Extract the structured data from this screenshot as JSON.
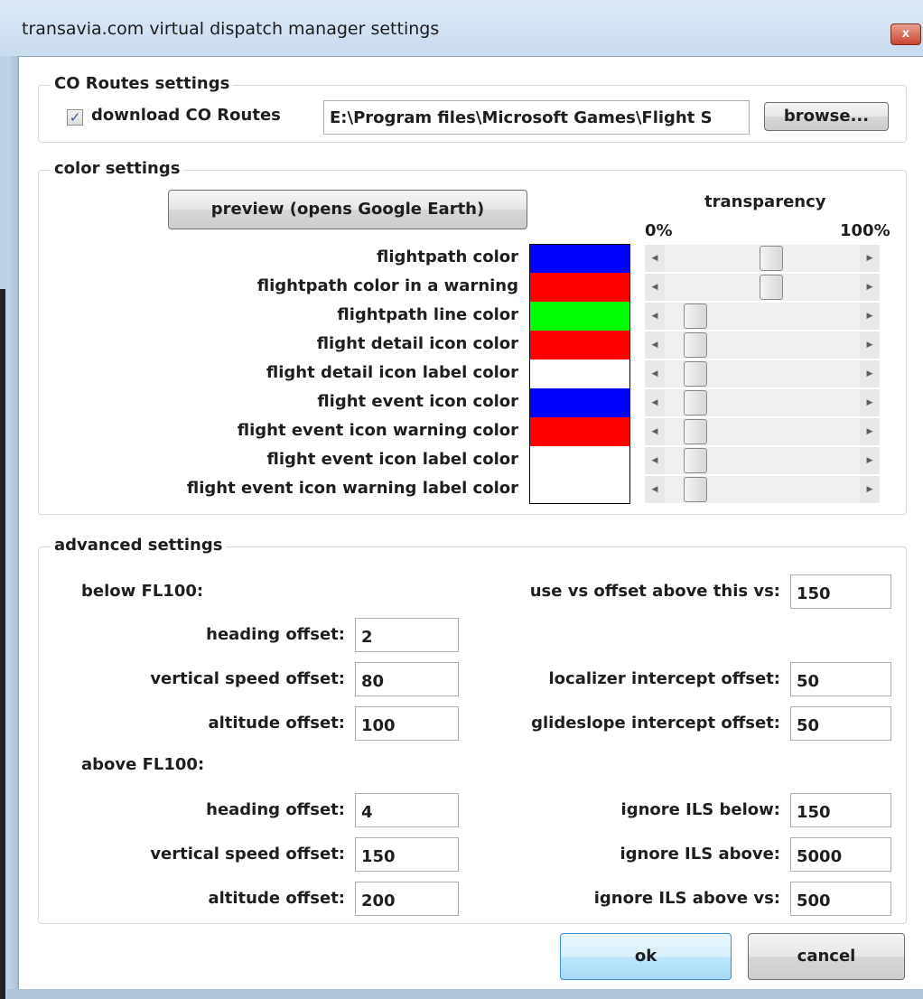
{
  "window": {
    "title": "transavia.com virtual dispatch manager settings",
    "close_glyph": "x"
  },
  "co_routes": {
    "legend": "CO Routes settings",
    "download_label": "download CO Routes",
    "download_checked": true,
    "path": "E:\\Program files\\Microsoft Games\\Flight S",
    "browse_label": "browse..."
  },
  "colors": {
    "legend": "color settings",
    "preview_label": "preview (opens Google Earth)",
    "transparency_label": "transparency",
    "min_label": "0%",
    "max_label": "100%",
    "items": [
      {
        "label": "flightpath color",
        "color": "#0000ff",
        "transparency": 0.55
      },
      {
        "label": "flightpath color in a warning",
        "color": "#ff0000",
        "transparency": 0.55
      },
      {
        "label": "flightpath line color",
        "color": "#00ff00",
        "transparency": 0.11
      },
      {
        "label": "flight detail icon color",
        "color": "#ff0000",
        "transparency": 0.11
      },
      {
        "label": "flight detail icon label color",
        "color": "#ffffff",
        "transparency": 0.11
      },
      {
        "label": "flight event icon color",
        "color": "#0000ff",
        "transparency": 0.11
      },
      {
        "label": "flight event icon warning color",
        "color": "#ff0000",
        "transparency": 0.11
      },
      {
        "label": "flight event icon label color",
        "color": "#ffffff",
        "transparency": 0.11
      },
      {
        "label": "flight event icon warning label color",
        "color": "#ffffff",
        "transparency": 0.11
      }
    ]
  },
  "advanced": {
    "legend": "advanced settings",
    "below_label": "below FL100:",
    "above_label": "above FL100:",
    "below": [
      {
        "label": "heading offset:",
        "value": "2"
      },
      {
        "label": "vertical speed offset:",
        "value": "80"
      },
      {
        "label": "altitude offset:",
        "value": "100"
      }
    ],
    "above": [
      {
        "label": "heading offset:",
        "value": "4"
      },
      {
        "label": "vertical speed offset:",
        "value": "150"
      },
      {
        "label": "altitude offset:",
        "value": "200"
      }
    ],
    "right": [
      {
        "label": "use vs offset above this vs:",
        "value": "150"
      },
      {
        "label": "localizer intercept offset:",
        "value": "50"
      },
      {
        "label": "glideslope intercept offset:",
        "value": "50"
      },
      {
        "label": "ignore ILS below:",
        "value": "150"
      },
      {
        "label": "ignore ILS above:",
        "value": "5000"
      },
      {
        "label": "ignore ILS above vs:",
        "value": "500"
      }
    ]
  },
  "buttons": {
    "ok": "ok",
    "cancel": "cancel"
  }
}
